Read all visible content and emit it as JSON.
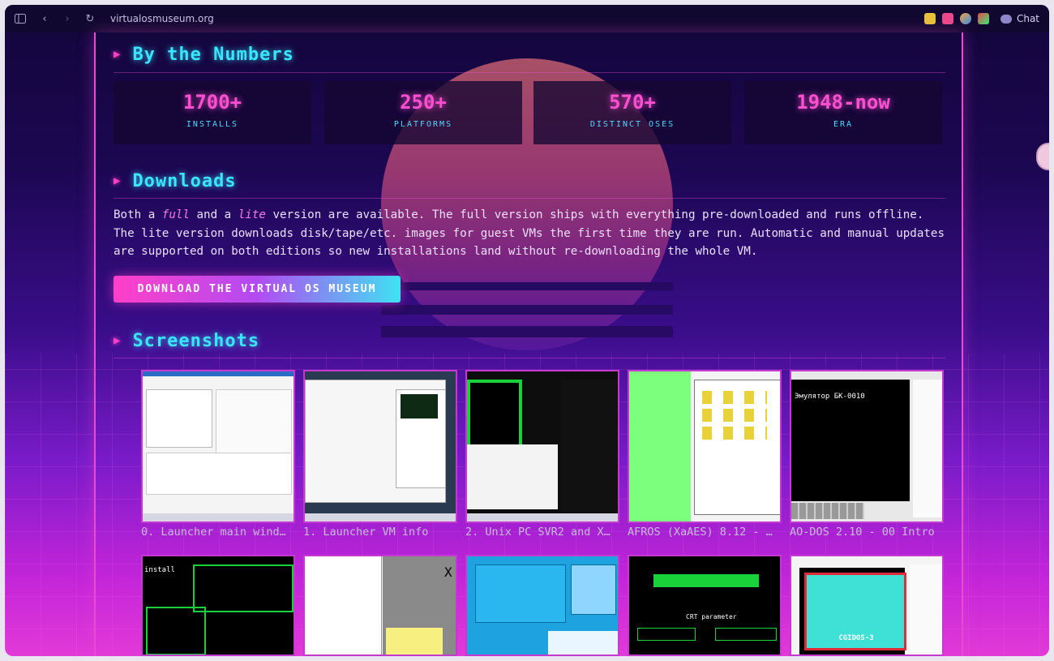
{
  "browser": {
    "url": "virtualosmuseum.org",
    "chat_label": "Chat"
  },
  "sections": {
    "numbers_title": "By the Numbers",
    "downloads_title": "Downloads",
    "screenshots_title": "Screenshots"
  },
  "stats": [
    {
      "value": "1700+",
      "label": "INSTALLS"
    },
    {
      "value": "250+",
      "label": "PLATFORMS"
    },
    {
      "value": "570+",
      "label": "DISTINCT OSES"
    },
    {
      "value": "1948-now",
      "label": "ERA"
    }
  ],
  "downloads": {
    "text_1": "Both a ",
    "full": "full",
    "text_2": " and a ",
    "lite": "lite",
    "text_3": " version are available. The full version ships with everything pre-downloaded and runs offline. The lite version downloads disk/tape/etc. images for guest VMs the first time they are run. Automatic and manual updates are supported on both editions so new installations land without re-downloading the whole VM.",
    "button": "DOWNLOAD THE VIRTUAL OS MUSEUM"
  },
  "screenshots": {
    "row1": [
      {
        "caption": "0. Launcher main wind…"
      },
      {
        "caption": "1. Launcher VM info"
      },
      {
        "caption": "2. Unix PC SVR2 and X…"
      },
      {
        "caption": "AFROS (XaAES) 8.12 - …"
      },
      {
        "caption": "AO-DOS 2.10 - 00 Intro"
      }
    ],
    "screen_text": {
      "bk_title": "Эмулятор БК-0010",
      "install": "install",
      "cgidos": "CGIDOS-3",
      "crt": "CRT parameter"
    }
  }
}
